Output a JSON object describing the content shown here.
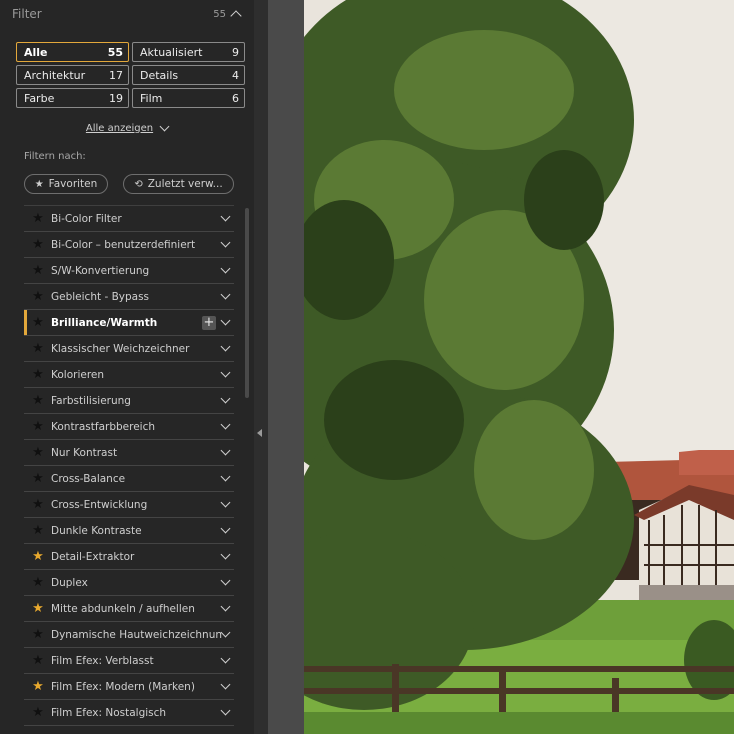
{
  "header": {
    "title": "Filter",
    "count": "55"
  },
  "categories": [
    {
      "label": "Alle",
      "count": "55",
      "active": true
    },
    {
      "label": "Aktualisiert",
      "count": "9"
    },
    {
      "label": "Architektur",
      "count": "17"
    },
    {
      "label": "Details",
      "count": "4"
    },
    {
      "label": "Farbe",
      "count": "19"
    },
    {
      "label": "Film",
      "count": "6"
    }
  ],
  "show_all_label": "Alle anzeigen",
  "filter_by_label": "Filtern nach:",
  "favorites_label": "Favoriten",
  "recent_label": "Zuletzt verw...",
  "filters": [
    {
      "label": "Bi-Color Filter",
      "fav": false
    },
    {
      "label": "Bi-Color – benutzerdefiniert",
      "fav": false
    },
    {
      "label": "S/W-Konvertierung",
      "fav": false
    },
    {
      "label": "Gebleicht - Bypass",
      "fav": false
    },
    {
      "label": "Brilliance/Warmth",
      "fav": false,
      "selected": true
    },
    {
      "label": "Klassischer Weichzeichner",
      "fav": false
    },
    {
      "label": "Kolorieren",
      "fav": false
    },
    {
      "label": "Farbstilisierung",
      "fav": false
    },
    {
      "label": "Kontrastfarbbereich",
      "fav": false
    },
    {
      "label": "Nur Kontrast",
      "fav": false
    },
    {
      "label": "Cross-Balance",
      "fav": false
    },
    {
      "label": "Cross-Entwicklung",
      "fav": false
    },
    {
      "label": "Dunkle Kontraste",
      "fav": false
    },
    {
      "label": "Detail-Extraktor",
      "fav": true
    },
    {
      "label": "Duplex",
      "fav": false
    },
    {
      "label": "Mitte abdunkeln / aufhellen",
      "fav": true
    },
    {
      "label": "Dynamische Hautweichzeichnung",
      "fav": false
    },
    {
      "label": "Film Efex: Verblasst",
      "fav": false
    },
    {
      "label": "Film Efex: Modern (Marken)",
      "fav": true
    },
    {
      "label": "Film Efex: Nostalgisch",
      "fav": false
    }
  ],
  "colors": {
    "accent": "#e3a83b",
    "sidebar_bg": "#262626",
    "canvas_bg": "#4a4a4a"
  }
}
